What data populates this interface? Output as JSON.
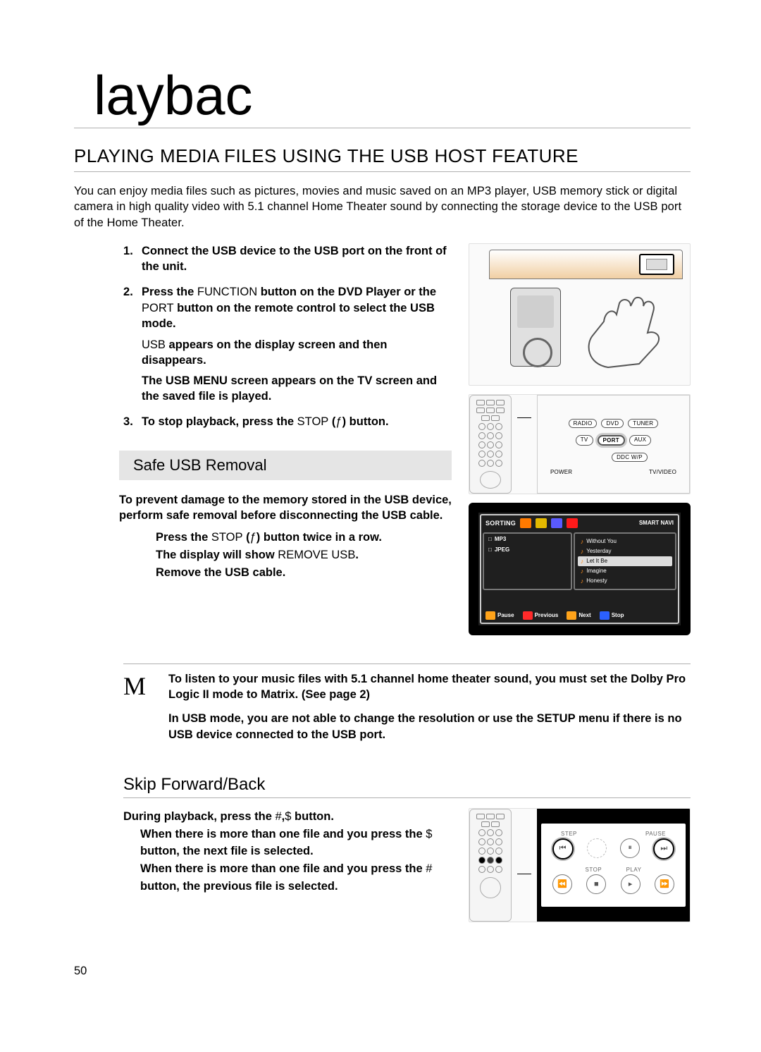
{
  "chapter_title": "laybac",
  "section_heading": "PLAYING MEDIA FILES USING THE USB HOST FEATURE",
  "intro": "You can enjoy media files such as pictures, movies and music saved on an MP3 player, USB memory stick or digital camera in high quality video with 5.1 channel Home Theater sound by connecting the storage device to the USB port of the Home Theater.",
  "steps": {
    "s1": "Connect the USB device to the USB port on the front of the unit.",
    "s2a": "Press the ",
    "s2_func": "FUNCTION",
    "s2b": " button on the DVD Player or the ",
    "s2_port": "PORT",
    "s2c": " button on the remote control to select the USB mode.",
    "s2_sub1a": "USB",
    "s2_sub1b": " appears on the display screen and then disappears.",
    "s2_sub2": "The USB MENU screen appears on the TV screen and the saved file is played.",
    "s3a": "To stop playback, press the ",
    "s3_stop": "STOP",
    "s3b": " (",
    "s3_glyph": "ƒ",
    "s3c": ") button."
  },
  "safe_usb": {
    "heading": "Safe USB Removal",
    "lead": "To prevent damage to the memory stored in the USB device, perform safe removal before disconnecting the USB cable.",
    "l1a": "Press the ",
    "l1_stop": "STOP",
    "l1b": " (",
    "l1_glyph": "ƒ",
    "l1c": ") button twice in a row.",
    "l2a": "The display will show ",
    "l2_msg": "REMOVE USB",
    "l2b": ".",
    "l3": "Remove the USB cable."
  },
  "panel1": {
    "radio": "RADIO",
    "dvd": "DVD",
    "tuner": "TUNER",
    "tv": "TV",
    "port": "PORT",
    "aux": "AUX",
    "power": "POWER",
    "tvvideo": "TV/VIDEO",
    "ddcwp": "DDC W/P"
  },
  "osd": {
    "sorting": "SORTING",
    "smart": "SMART NAVI",
    "folders": [
      "MP3",
      "JPEG"
    ],
    "files": [
      "Without You",
      "Yesterday",
      "Let It Be",
      "Imagine",
      "Honesty"
    ],
    "selected_index": 2,
    "keys": {
      "pause": "Pause",
      "previous": "Previous",
      "next": "Next",
      "stop": "Stop"
    }
  },
  "notes": {
    "icon": "M",
    "n1": "To listen to your music files with 5.1 channel home theater sound, you must set the Dolby Pro Logic II mode to Matrix. (See page 2)",
    "n2": "In USB mode, you are not able to change the resolution or use the SETUP menu if there is no USB device connected to the USB port."
  },
  "skip": {
    "heading": "Skip Forward/Back",
    "d1a": "During playback, press the ",
    "d1_g1": "#",
    "d1b": ",",
    "d1_g2": "$",
    "d1c": " button.",
    "b1a": "When there is more than one file and you press the ",
    "b1_g": "$",
    "b1b": " button, the next file is selected.",
    "b2a": "When there is more than one file and you press the ",
    "b2_g": "#",
    "b2b": " button, the previous file is selected."
  },
  "panel2": {
    "labels_top": [
      "STEP",
      "PAUSE"
    ],
    "labels_bottom": [
      "STOP",
      "PLAY"
    ]
  },
  "page_number": 50
}
